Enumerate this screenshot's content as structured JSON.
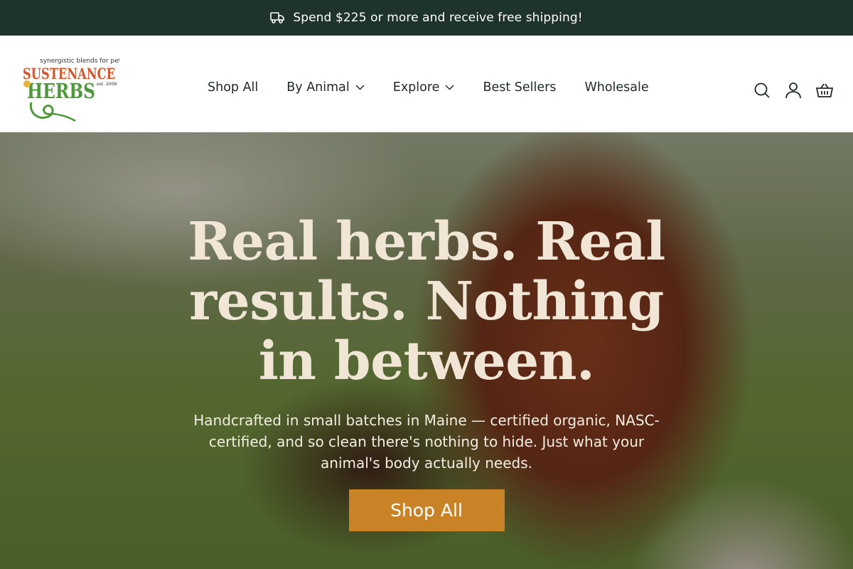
{
  "announcement": {
    "text": "Spend $225 or more and receive free shipping!",
    "icon": "truck-icon"
  },
  "logo": {
    "tagline": "synergistic blends for pets",
    "word1": "SUSTENANCE",
    "word2": "HERBS",
    "est": "est. 2008"
  },
  "nav": {
    "items": [
      {
        "label": "Shop All",
        "dropdown": false
      },
      {
        "label": "By Animal",
        "dropdown": true
      },
      {
        "label": "Explore",
        "dropdown": true
      },
      {
        "label": "Best Sellers",
        "dropdown": false
      },
      {
        "label": "Wholesale",
        "dropdown": false
      }
    ]
  },
  "actions": {
    "icons": [
      "search-icon",
      "account-icon",
      "basket-icon"
    ]
  },
  "hero": {
    "title": "Real herbs. Real results. Nothing in between.",
    "subtitle": "Handcrafted in small batches in Maine — certified organic, NASC-certified, and so clean there's nothing to hide. Just what your animal's body actually needs.",
    "button": "Shop All"
  },
  "colors": {
    "announcement_bg": "#1e3329",
    "button_bg": "#c98326",
    "hero_title": "#f1e6d6"
  }
}
